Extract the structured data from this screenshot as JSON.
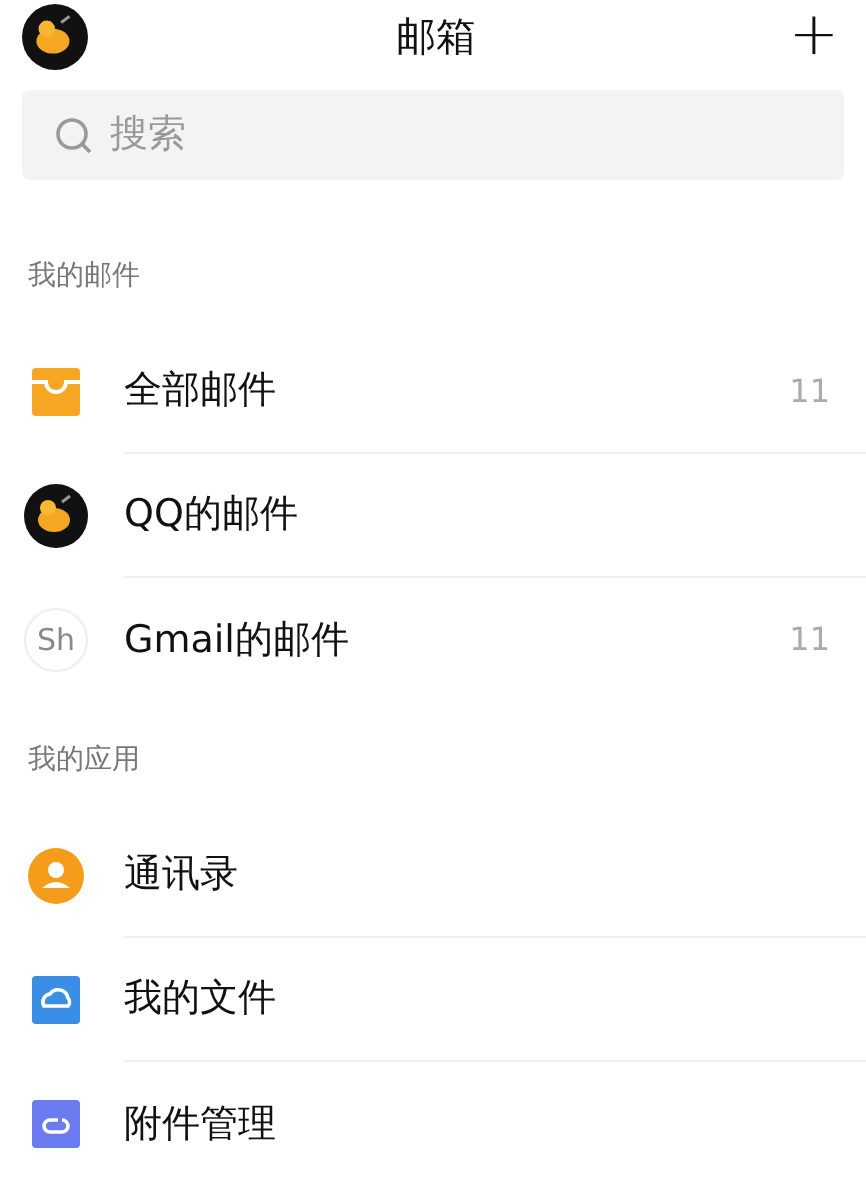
{
  "header": {
    "title": "邮箱",
    "add_label": "+"
  },
  "search": {
    "placeholder": "搜索"
  },
  "sections": [
    {
      "title": "我的邮件",
      "items": [
        {
          "kind": "inbox",
          "label": "全部邮件",
          "count": "11"
        },
        {
          "kind": "avatar",
          "label": "QQ的邮件"
        },
        {
          "kind": "initials",
          "initials": "Sh",
          "label": "Gmail的邮件",
          "count": "11"
        }
      ]
    },
    {
      "title": "我的应用",
      "items": [
        {
          "kind": "contacts",
          "label": "通讯录"
        },
        {
          "kind": "files",
          "label": "我的文件"
        },
        {
          "kind": "attachments",
          "label": "附件管理"
        }
      ]
    }
  ]
}
